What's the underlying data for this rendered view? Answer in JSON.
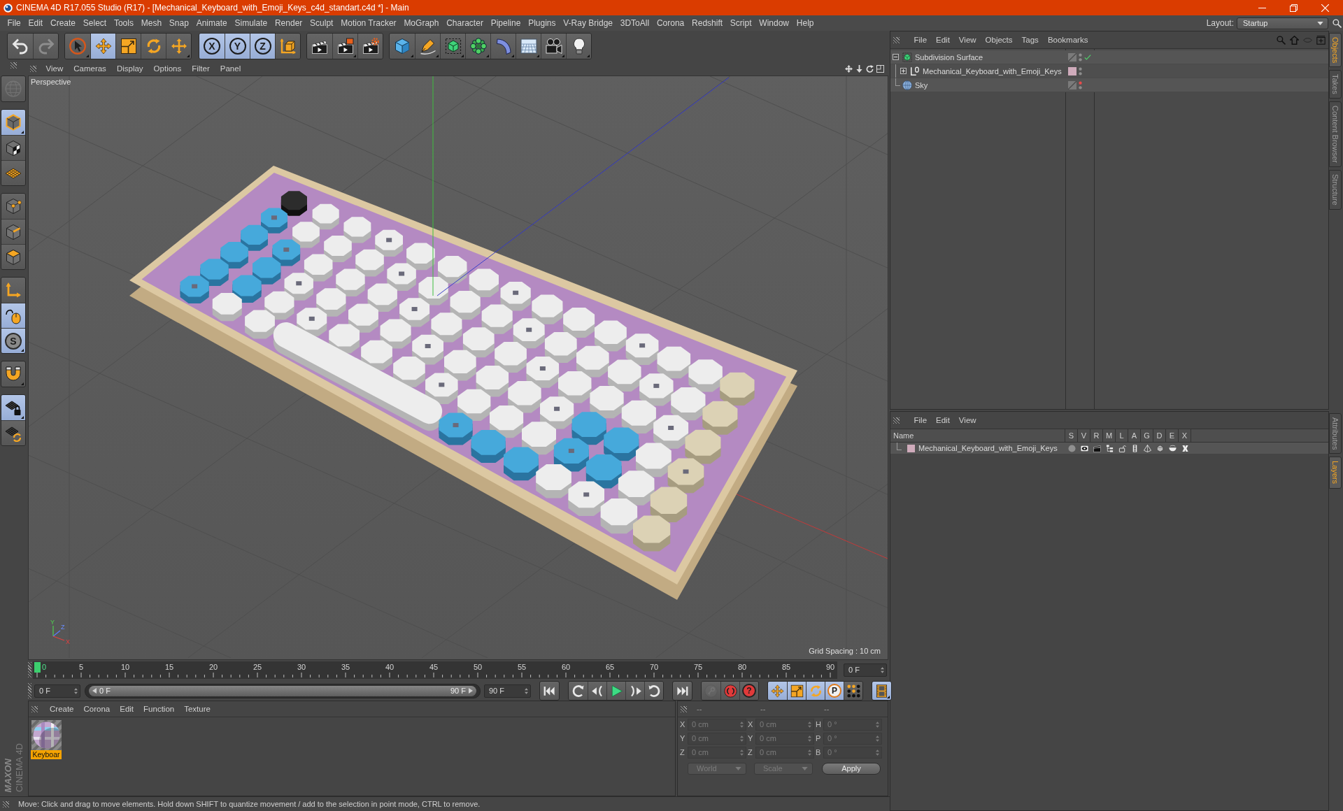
{
  "window": {
    "title": "CINEMA 4D R17.055 Studio (R17) - [Mechanical_Keyboard_with_Emoji_Keys_c4d_standart.c4d *] - Main"
  },
  "menu_bar": {
    "items": [
      "File",
      "Edit",
      "Create",
      "Select",
      "Tools",
      "Mesh",
      "Snap",
      "Animate",
      "Simulate",
      "Render",
      "Sculpt",
      "Motion Tracker",
      "MoGraph",
      "Character",
      "Pipeline",
      "Plugins",
      "V-Ray Bridge",
      "3DToAll",
      "Corona",
      "Redshift",
      "Script",
      "Window",
      "Help"
    ],
    "layout_label": "Layout:",
    "layout_value": "Startup"
  },
  "main_toolbar": [
    [
      {
        "kind": "undo",
        "active": false
      },
      {
        "kind": "redo",
        "active": false,
        "disabled": true
      }
    ],
    [
      {
        "kind": "live-selection",
        "active": false,
        "submenu": true
      },
      {
        "kind": "move",
        "active": true
      },
      {
        "kind": "scale",
        "active": false
      },
      {
        "kind": "rotate",
        "active": false
      },
      {
        "kind": "transform",
        "active": false,
        "submenu": true
      }
    ],
    [
      {
        "kind": "axis-lock",
        "label": "X",
        "active": true
      },
      {
        "kind": "axis-lock",
        "label": "Y",
        "active": true
      },
      {
        "kind": "axis-lock",
        "label": "Z",
        "active": true
      },
      {
        "kind": "coordinate-system",
        "active": false
      }
    ],
    [
      {
        "kind": "render-view",
        "active": false
      },
      {
        "kind": "render-picture-viewer",
        "active": false,
        "submenu": true
      },
      {
        "kind": "render-settings",
        "active": false
      }
    ],
    [
      {
        "kind": "cube",
        "active": false,
        "submenu": true
      },
      {
        "kind": "pen",
        "active": false,
        "submenu": true
      },
      {
        "kind": "subdivision",
        "active": false,
        "submenu": true
      },
      {
        "kind": "cloner",
        "active": false,
        "submenu": true
      },
      {
        "kind": "bend",
        "active": false,
        "submenu": true
      },
      {
        "kind": "floor",
        "active": false,
        "submenu": true
      },
      {
        "kind": "camera",
        "active": false,
        "submenu": true
      },
      {
        "kind": "light",
        "active": false,
        "submenu": true
      }
    ]
  ],
  "left_toolbar": [
    [
      {
        "kind": "make-editable",
        "active": false,
        "disabled": true
      }
    ],
    [
      {
        "kind": "model",
        "active": true,
        "submenu": true
      },
      {
        "kind": "texture",
        "active": false
      },
      {
        "kind": "workplane",
        "active": false
      }
    ],
    [
      {
        "kind": "points",
        "active": false
      },
      {
        "kind": "edges",
        "active": false
      },
      {
        "kind": "polygons",
        "active": false
      }
    ],
    [
      {
        "kind": "axis",
        "active": false
      },
      {
        "kind": "tweak",
        "active": true
      },
      {
        "kind": "solo",
        "label": "S",
        "active": true,
        "submenu": true
      }
    ],
    [
      {
        "kind": "snap",
        "active": false,
        "submenu": true
      }
    ],
    [
      {
        "kind": "workplane-lock",
        "active": true,
        "submenu": true
      },
      {
        "kind": "workplane-grid",
        "active": false
      }
    ]
  ],
  "viewport": {
    "menu": [
      "View",
      "Cameras",
      "Display",
      "Options",
      "Filter",
      "Panel"
    ],
    "camera": "Perspective",
    "grid_spacing": "Grid Spacing : 10 cm",
    "axis_labels": [
      "Y",
      "Z",
      "X"
    ]
  },
  "timeline": {
    "frames": [
      "0",
      "5",
      "10",
      "15",
      "20",
      "25",
      "30",
      "35",
      "40",
      "45",
      "50",
      "55",
      "60",
      "65",
      "70",
      "75",
      "80",
      "85",
      "90"
    ],
    "level": 0,
    "current_frame": "0 F",
    "start_field": "0 F",
    "range": {
      "start": "0 F",
      "end": "90 F",
      "level": 1
    },
    "end_field": "90 F"
  },
  "transport": [
    [
      {
        "kind": "go-start",
        "active": false
      }
    ],
    [
      {
        "kind": "previous-key",
        "active": false
      },
      {
        "kind": "previous-frame",
        "active": false
      },
      {
        "kind": "play",
        "active": false
      },
      {
        "kind": "next-frame",
        "active": false
      },
      {
        "kind": "next-key",
        "active": false
      }
    ],
    [
      {
        "kind": "go-end",
        "active": false
      }
    ],
    [
      {
        "kind": "record-keys",
        "active": false,
        "disabled": true
      },
      {
        "kind": "autokey",
        "active": false
      },
      {
        "kind": "keyframe-selection",
        "label": "?",
        "active": false
      }
    ],
    [
      {
        "kind": "key-position",
        "active": true
      },
      {
        "kind": "key-scale",
        "active": true
      },
      {
        "kind": "key-rotation",
        "active": true
      },
      {
        "kind": "key-parameter",
        "label": "P",
        "active": true
      },
      {
        "kind": "key-point-level",
        "active": false
      }
    ],
    [
      {
        "kind": "timeline-window",
        "active": true,
        "submenu": true
      }
    ]
  ],
  "material_manager": {
    "menu": [
      "Create",
      "Corona",
      "Edit",
      "Function",
      "Texture"
    ],
    "materials": [
      {
        "name": "Keyboar",
        "selected": true
      }
    ]
  },
  "coordinates": {
    "headers": [
      "--",
      "--",
      "--"
    ],
    "disabled": true,
    "rows": [
      {
        "position_axis": "X",
        "position": "0 cm",
        "size_axis": "X",
        "size": "0 cm",
        "rotation_axis": "H",
        "rotation": "0 °"
      },
      {
        "position_axis": "Y",
        "position": "0 cm",
        "size_axis": "Y",
        "size": "0 cm",
        "rotation_axis": "P",
        "rotation": "0 °"
      },
      {
        "position_axis": "Z",
        "position": "0 cm",
        "size_axis": "Z",
        "size": "0 cm",
        "rotation_axis": "B",
        "rotation": "0 °"
      }
    ],
    "coordinate_mode": "World",
    "size_mode": "Scale",
    "apply_label": "Apply"
  },
  "status_bar": {
    "text": "Move: Click and drag to move elements. Hold down SHIFT to quantize movement / add to the selection in point mode, CTRL to remove."
  },
  "brand": {
    "company": "MAXON",
    "product": "CINEMA 4D"
  },
  "object_manager": {
    "menu": [
      "File",
      "Edit",
      "View",
      "Objects",
      "Tags",
      "Bookmarks"
    ],
    "objects": [
      {
        "name": "Subdivision Surface",
        "kind": "subdivision",
        "expanded": true,
        "enabled": true,
        "hidden_in_editor": false,
        "hidden_in_render": false,
        "children": [
          {
            "name": "Mechanical_Keyboard_with_Emoji_Keys",
            "kind": "null",
            "expanded": false,
            "color": "#cfabbb",
            "hidden_in_editor": false,
            "hidden_in_render": false
          }
        ]
      },
      {
        "name": "Sky",
        "kind": "sky",
        "hidden_in_editor": true,
        "hidden_in_render": false
      }
    ]
  },
  "layer_manager": {
    "menu": [
      "File",
      "Edit",
      "View"
    ],
    "columns": [
      "Name",
      "S",
      "V",
      "R",
      "M",
      "L",
      "A",
      "G",
      "D",
      "E",
      "X"
    ],
    "layers": [
      {
        "name": "Mechanical_Keyboard_with_Emoji_Keys",
        "color": "#cfabbb",
        "solo": false,
        "visible": true,
        "render": true,
        "manager": true,
        "locked": false,
        "animation": true,
        "generators": true,
        "deformers": true,
        "expressions": true,
        "xref": true
      }
    ]
  },
  "side_tabs": {
    "upper": [
      {
        "label": "Objects",
        "selected": true
      },
      {
        "label": "Takes",
        "selected": false
      },
      {
        "label": "Content Browser",
        "selected": false
      },
      {
        "label": "Structure",
        "selected": false
      }
    ],
    "lower": [
      {
        "label": "Attributes",
        "selected": false
      },
      {
        "label": "Layers",
        "selected": true
      }
    ]
  }
}
